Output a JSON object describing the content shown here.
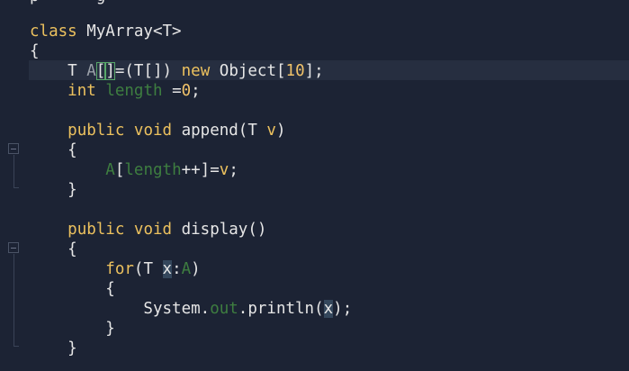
{
  "editor": {
    "partial_top_line": "p      g  ",
    "lines": [
      {
        "tokens": [
          {
            "t": "class ",
            "c": "kw"
          },
          {
            "t": "MyArray<T>",
            "c": "plain"
          }
        ]
      },
      {
        "tokens": [
          {
            "t": "{",
            "c": "plain"
          }
        ]
      },
      {
        "tokens": [
          {
            "t": "    T ",
            "c": "plain"
          },
          {
            "t": "A",
            "c": "caret"
          },
          {
            "t": "[",
            "c": "plain bracket"
          },
          {
            "t": "]",
            "c": "plain bracket"
          },
          {
            "t": "=(T[]) ",
            "c": "plain"
          },
          {
            "t": "new ",
            "c": "kw"
          },
          {
            "t": "Object[",
            "c": "plain"
          },
          {
            "t": "10",
            "c": "num"
          },
          {
            "t": "];",
            "c": "plain"
          }
        ]
      },
      {
        "tokens": [
          {
            "t": "    ",
            "c": "plain"
          },
          {
            "t": "int ",
            "c": "kw"
          },
          {
            "t": "length",
            "c": "fld"
          },
          {
            "t": " =",
            "c": "plain"
          },
          {
            "t": "0",
            "c": "num"
          },
          {
            "t": ";",
            "c": "plain"
          }
        ]
      },
      {
        "tokens": [
          {
            "t": "",
            "c": "plain"
          }
        ]
      },
      {
        "tokens": [
          {
            "t": "    ",
            "c": "plain"
          },
          {
            "t": "public void ",
            "c": "kw"
          },
          {
            "t": "append(T ",
            "c": "plain"
          },
          {
            "t": "v",
            "c": "kw"
          },
          {
            "t": ")",
            "c": "plain"
          }
        ]
      },
      {
        "tokens": [
          {
            "t": "    {",
            "c": "plain"
          }
        ]
      },
      {
        "tokens": [
          {
            "t": "        ",
            "c": "plain"
          },
          {
            "t": "A",
            "c": "fld"
          },
          {
            "t": "[",
            "c": "plain"
          },
          {
            "t": "length",
            "c": "fld"
          },
          {
            "t": "++]=",
            "c": "plain"
          },
          {
            "t": "v",
            "c": "kw"
          },
          {
            "t": ";",
            "c": "plain"
          }
        ]
      },
      {
        "tokens": [
          {
            "t": "    }",
            "c": "plain"
          }
        ]
      },
      {
        "tokens": [
          {
            "t": "",
            "c": "plain"
          }
        ]
      },
      {
        "tokens": [
          {
            "t": "    ",
            "c": "plain"
          },
          {
            "t": "public void ",
            "c": "kw"
          },
          {
            "t": "display()",
            "c": "plain"
          }
        ]
      },
      {
        "tokens": [
          {
            "t": "    {",
            "c": "plain"
          }
        ]
      },
      {
        "tokens": [
          {
            "t": "        ",
            "c": "plain"
          },
          {
            "t": "for",
            "c": "kw"
          },
          {
            "t": "(T ",
            "c": "plain"
          },
          {
            "t": "x",
            "c": "plain sel"
          },
          {
            "t": ":",
            "c": "plain"
          },
          {
            "t": "A",
            "c": "fld"
          },
          {
            "t": ")",
            "c": "plain"
          }
        ]
      },
      {
        "tokens": [
          {
            "t": "        {",
            "c": "plain"
          }
        ]
      },
      {
        "tokens": [
          {
            "t": "            System.",
            "c": "plain"
          },
          {
            "t": "out",
            "c": "fld"
          },
          {
            "t": ".println(",
            "c": "plain"
          },
          {
            "t": "x",
            "c": "plain sel"
          },
          {
            "t": ");",
            "c": "plain"
          }
        ]
      },
      {
        "tokens": [
          {
            "t": "        }",
            "c": "plain"
          }
        ]
      },
      {
        "tokens": [
          {
            "t": "    }",
            "c": "plain"
          }
        ]
      }
    ]
  },
  "gutter": {
    "fold_markers": [
      {
        "name": "fold-append",
        "icon": "fold-collapse-icon"
      },
      {
        "name": "fold-display",
        "icon": "fold-collapse-icon"
      }
    ]
  },
  "colors": {
    "background": "#1c2334",
    "keyword": "#ecc15e",
    "field": "#3e7e40",
    "number": "#f0c26a",
    "text": "#e6e6e6"
  }
}
